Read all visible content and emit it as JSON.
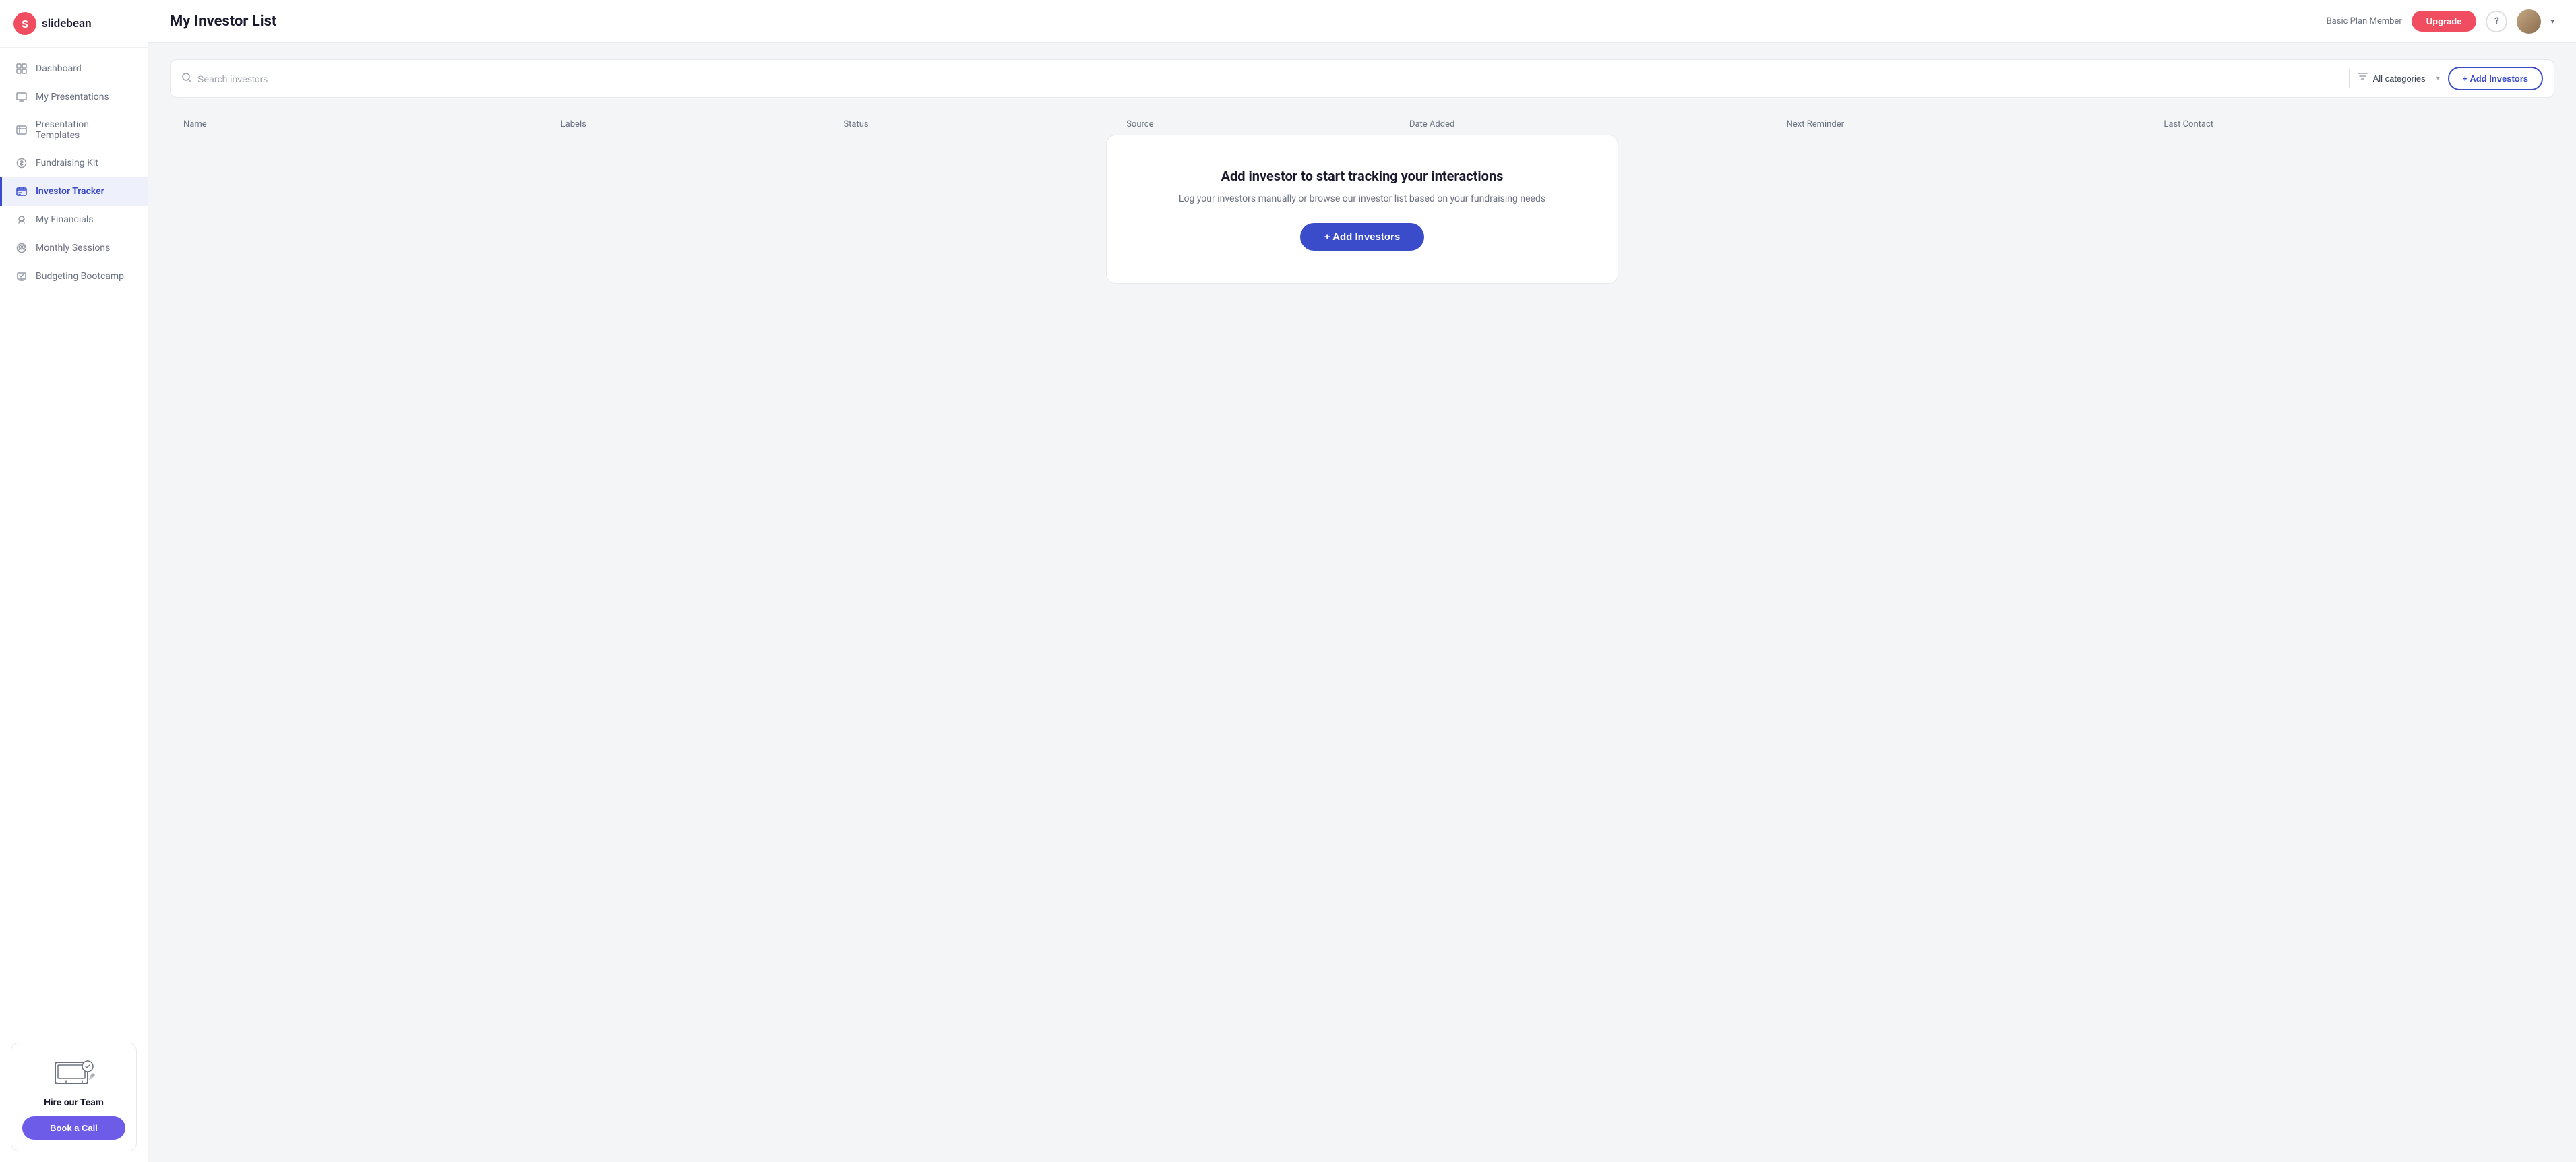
{
  "logo": {
    "letter": "S",
    "text": "slidebean"
  },
  "sidebar": {
    "items": [
      {
        "id": "dashboard",
        "label": "Dashboard",
        "icon": "grid-icon",
        "active": false
      },
      {
        "id": "my-presentations",
        "label": "My Presentations",
        "icon": "presentation-icon",
        "active": false
      },
      {
        "id": "presentation-templates",
        "label": "Presentation Templates",
        "icon": "template-icon",
        "active": false
      },
      {
        "id": "fundraising-kit",
        "label": "Fundraising Kit",
        "icon": "dollar-icon",
        "active": false
      },
      {
        "id": "investor-tracker",
        "label": "Investor Tracker",
        "icon": "tracker-icon",
        "active": true
      },
      {
        "id": "my-financials",
        "label": "My Financials",
        "icon": "financials-icon",
        "active": false
      },
      {
        "id": "monthly-sessions",
        "label": "Monthly Sessions",
        "icon": "sessions-icon",
        "active": false
      },
      {
        "id": "budgeting-bootcamp",
        "label": "Budgeting Bootcamp",
        "icon": "bootcamp-icon",
        "active": false
      }
    ],
    "hire_card": {
      "title": "Hire our Team",
      "button_label": "Book a Call"
    }
  },
  "header": {
    "title": "My Investor List",
    "plan_text": "Basic Plan Member",
    "upgrade_label": "Upgrade",
    "help_label": "?",
    "chevron": "▾"
  },
  "toolbar": {
    "search_placeholder": "Search investors",
    "filter_label": "All categories",
    "add_investors_label": "+ Add Investors"
  },
  "table": {
    "columns": [
      "Name",
      "Labels",
      "Status",
      "Source",
      "Date Added",
      "Next Reminder",
      "Last Contact"
    ]
  },
  "empty_state": {
    "title": "Add investor to start tracking your interactions",
    "subtitle": "Log your investors manually or browse our investor list based on your fundraising needs",
    "button_label": "+ Add Investors"
  }
}
